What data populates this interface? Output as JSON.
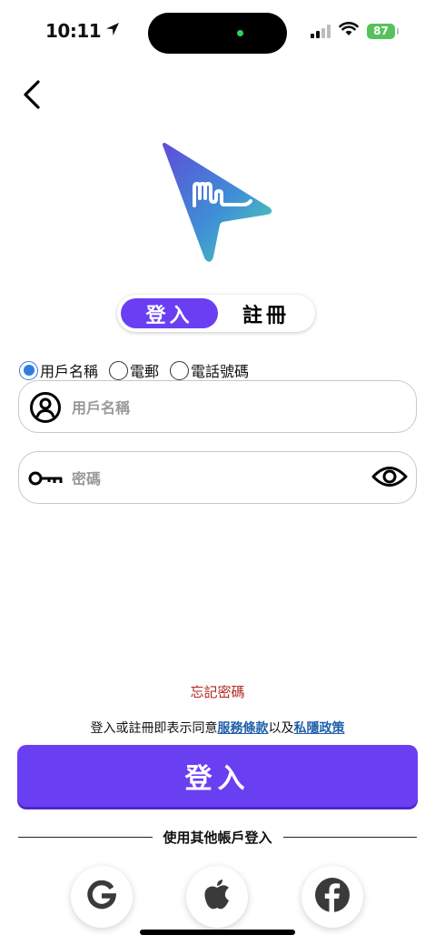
{
  "status_bar": {
    "time": "10:11",
    "battery": "87"
  },
  "auth_tabs": {
    "login": "登入",
    "register": "註冊",
    "active": "login"
  },
  "login_method": {
    "options": [
      "用戶名稱",
      "電郵",
      "電話號碼"
    ],
    "selected": "用戶名稱"
  },
  "username_field": {
    "placeholder": "用戶名稱",
    "value": ""
  },
  "password_field": {
    "placeholder": "密碼",
    "value": ""
  },
  "forgot_password": "忘記密碼",
  "terms": {
    "prefix": "登入或註冊即表示同意",
    "terms_link": "服務條款",
    "connector": "以及",
    "privacy_link": "私隱政策"
  },
  "login_button": "登入",
  "other_login": {
    "label": "使用其他帳戶登入",
    "providers": [
      "google-icon",
      "apple-icon",
      "facebook-icon"
    ]
  },
  "colors": {
    "accent": "#6a3ff2",
    "radio_selected": "#2f7de1",
    "forgot": "#b3261e",
    "link": "#1f5fa8",
    "battery": "#57c15c"
  }
}
